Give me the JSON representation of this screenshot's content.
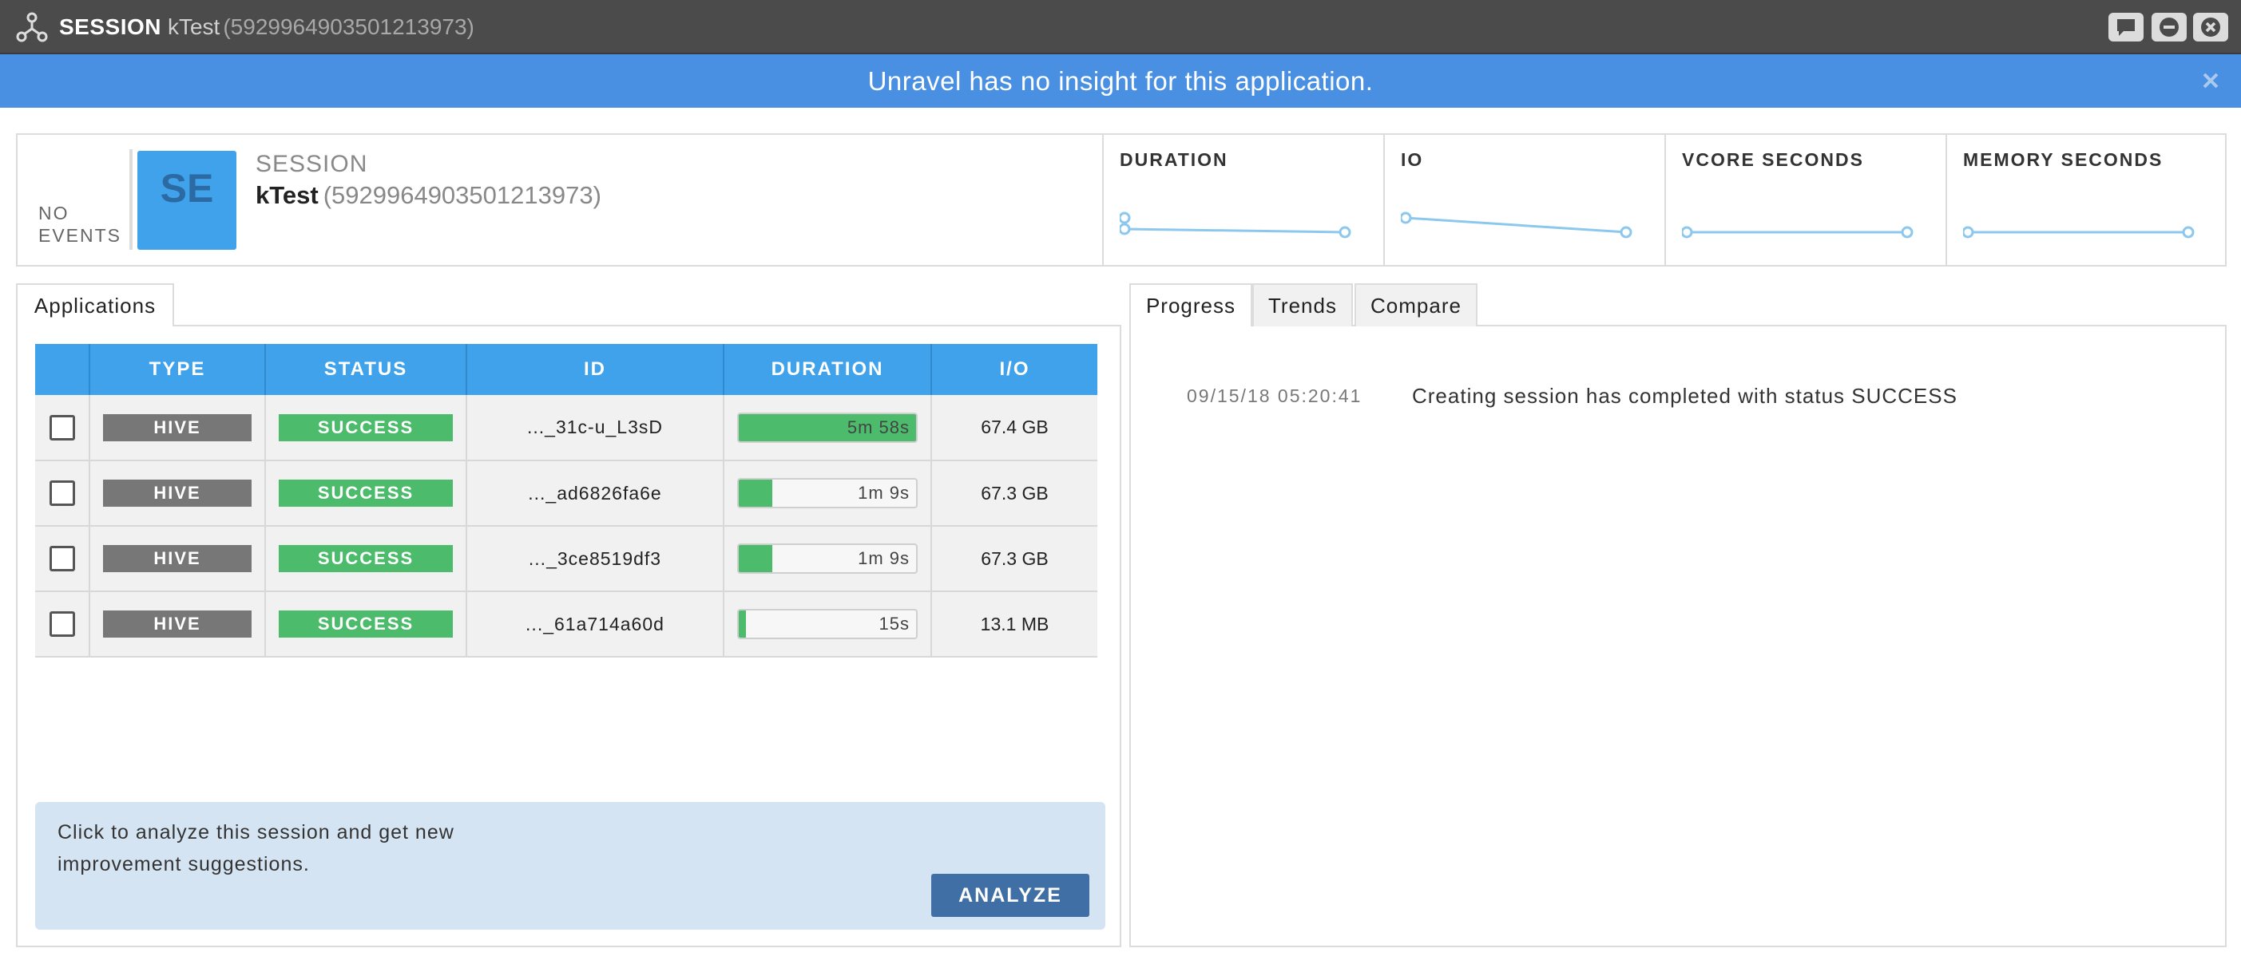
{
  "window": {
    "kind": "SESSION",
    "name": "kTest",
    "id": "(5929964903501213973)",
    "icons": [
      "topology-icon",
      "chat-icon",
      "minimize-icon",
      "close-icon"
    ]
  },
  "banner": {
    "message": "Unravel has no insight for this application.",
    "color": "#4a90e2"
  },
  "header": {
    "no_events": "NO EVENTS",
    "avatar": "SE",
    "kind": "SESSION",
    "name": "kTest",
    "id": "(5929964903501213973)",
    "metrics": [
      {
        "label": "DURATION"
      },
      {
        "label": "IO"
      },
      {
        "label": "VCORE SECONDS"
      },
      {
        "label": "MEMORY SECONDS"
      }
    ]
  },
  "left_tabs": {
    "applications": "Applications"
  },
  "apps_table": {
    "columns": [
      "",
      "TYPE",
      "STATUS",
      "ID",
      "DURATION",
      "I/O"
    ],
    "rows": [
      {
        "type": "HIVE",
        "status": "SUCCESS",
        "id": "..._31c-u_L3sD",
        "duration": "5m 58s",
        "duration_fraction": 1.0,
        "io": "67.4 GB"
      },
      {
        "type": "HIVE",
        "status": "SUCCESS",
        "id": "..._ad6826fa6e",
        "duration": "1m 9s",
        "duration_fraction": 0.19,
        "io": "67.3 GB"
      },
      {
        "type": "HIVE",
        "status": "SUCCESS",
        "id": "..._3ce8519df3",
        "duration": "1m 9s",
        "duration_fraction": 0.19,
        "io": "67.3 GB"
      },
      {
        "type": "HIVE",
        "status": "SUCCESS",
        "id": "..._61a714a60d",
        "duration": "15s",
        "duration_fraction": 0.04,
        "io": "13.1 MB"
      }
    ]
  },
  "analyze": {
    "text": "Click to analyze this session and get new improvement suggestions.",
    "button": "ANALYZE"
  },
  "right_tabs": {
    "progress": "Progress",
    "trends": "Trends",
    "compare": "Compare"
  },
  "progress": {
    "events": [
      {
        "time": "09/15/18 05:20:41",
        "text": "Creating session has completed with status SUCCESS"
      }
    ]
  },
  "colors": {
    "accent": "#3fa2ea",
    "success": "#4cbb6c",
    "type_badge": "#777777",
    "analyze_button": "#3f6fa5"
  }
}
